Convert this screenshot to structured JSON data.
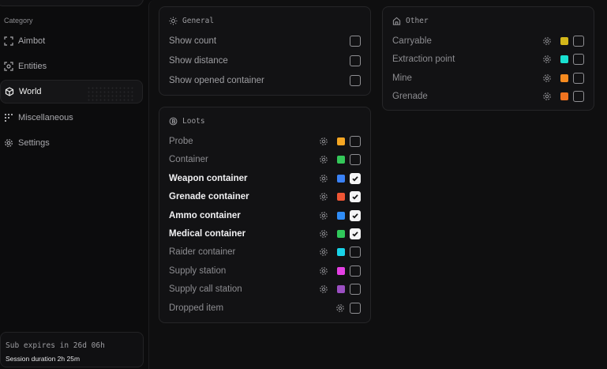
{
  "sidebar": {
    "category_label": "Category",
    "items": [
      {
        "label": "Aimbot",
        "icon": "crosshair-icon"
      },
      {
        "label": "Entities",
        "icon": "target-icon"
      },
      {
        "label": "World",
        "icon": "cube-icon",
        "active": true
      },
      {
        "label": "Miscellaneous",
        "icon": "grid-icon"
      },
      {
        "label": "Settings",
        "icon": "gear-icon"
      }
    ],
    "subscription": {
      "expires": "Sub expires in 26d 06h",
      "session": "Session duration 2h 25m"
    }
  },
  "general": {
    "title": "General",
    "icon": "sun-icon",
    "rows": [
      {
        "label": "Show count",
        "checked": false
      },
      {
        "label": "Show distance",
        "checked": false
      },
      {
        "label": "Show opened container",
        "checked": false
      }
    ]
  },
  "loots": {
    "title": "Loots",
    "icon": "coin-icon",
    "rows": [
      {
        "label": "Probe",
        "color": "#f5a623",
        "checked": false
      },
      {
        "label": "Container",
        "color": "#34c759",
        "checked": false
      },
      {
        "label": "Weapon container",
        "color": "#3a82f7",
        "checked": true
      },
      {
        "label": "Grenade container",
        "color": "#ee5534",
        "checked": true
      },
      {
        "label": "Ammo container",
        "color": "#2f8cf6",
        "checked": true
      },
      {
        "label": "Medical container",
        "color": "#30c85a",
        "checked": true
      },
      {
        "label": "Raider container",
        "color": "#19d3e8",
        "checked": false
      },
      {
        "label": "Supply station",
        "color": "#e440e4",
        "checked": false
      },
      {
        "label": "Supply call station",
        "color": "#9b4fc2",
        "checked": false
      },
      {
        "label": "Dropped item",
        "color": null,
        "checked": false
      }
    ]
  },
  "other": {
    "title": "Other",
    "icon": "home-icon",
    "rows": [
      {
        "label": "Carryable",
        "color": "#d4b71a",
        "checked": false
      },
      {
        "label": "Extraction point",
        "color": "#19e0d0",
        "checked": false
      },
      {
        "label": "Mine",
        "color": "#f58a1f",
        "checked": false
      },
      {
        "label": "Grenade",
        "color": "#f0731f",
        "checked": false
      }
    ]
  }
}
